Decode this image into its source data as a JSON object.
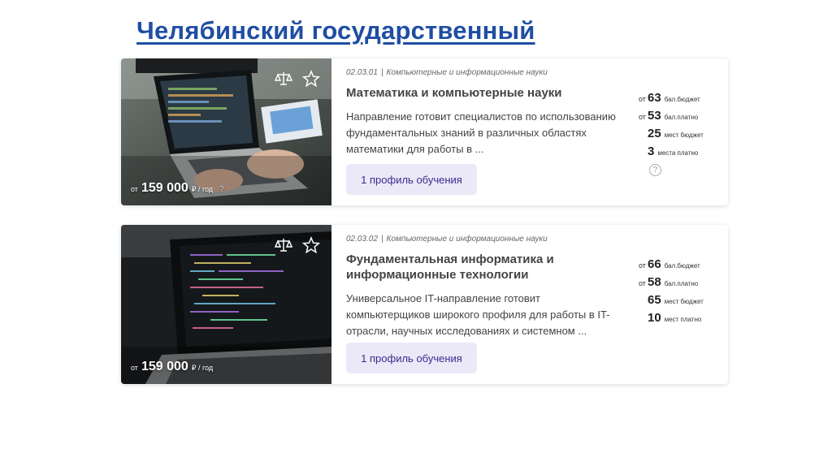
{
  "header": {
    "title": "Челябинский государственный"
  },
  "programs": [
    {
      "code": "02.03.01",
      "category": "Компьютерные и информационные науки",
      "title": "Математика и компьютерные науки",
      "description": "Направление готовит специалистов по использованию фундаментальных знаний в различных областях математики для работы в ...",
      "profile_button": "1 профиль обучения",
      "price_prefix": "от",
      "price": "159 000",
      "price_unit": "₽ / год",
      "price_help": "?",
      "stats": [
        {
          "prefix": "от",
          "value": "63",
          "label": "бал.бюджет"
        },
        {
          "prefix": "от",
          "value": "53",
          "label": "бал.платно"
        },
        {
          "prefix": "",
          "value": "25",
          "label": "мест бюджет"
        },
        {
          "prefix": "",
          "value": "3",
          "label": "места платно"
        }
      ],
      "stats_help": "?",
      "icons": [
        "compare-scales-icon",
        "favorite-star-icon"
      ]
    },
    {
      "code": "02.03.02",
      "category": "Компьютерные и информационные науки",
      "title": "Фундаментальная информатика и информационные технологии",
      "description": "Универсальное IT-направление готовит компьютерщиков широкого профиля для работы в IT-отрасли, научных исследованиях и системном ...",
      "profile_button": "1 профиль обучения",
      "price_prefix": "от",
      "price": "159 000",
      "price_unit": "₽ / год",
      "stats": [
        {
          "prefix": "от",
          "value": "66",
          "label": "бал.бюджет"
        },
        {
          "prefix": "от",
          "value": "58",
          "label": "бал.платно"
        },
        {
          "prefix": "",
          "value": "65",
          "label": "мест бюджет"
        },
        {
          "prefix": "",
          "value": "10",
          "label": "мест платно"
        }
      ],
      "icons": [
        "compare-scales-icon",
        "favorite-star-icon"
      ]
    }
  ],
  "colors": {
    "title": "#1f4ea3",
    "button_bg": "#ebe8f8",
    "button_text": "#3a2c8c"
  }
}
